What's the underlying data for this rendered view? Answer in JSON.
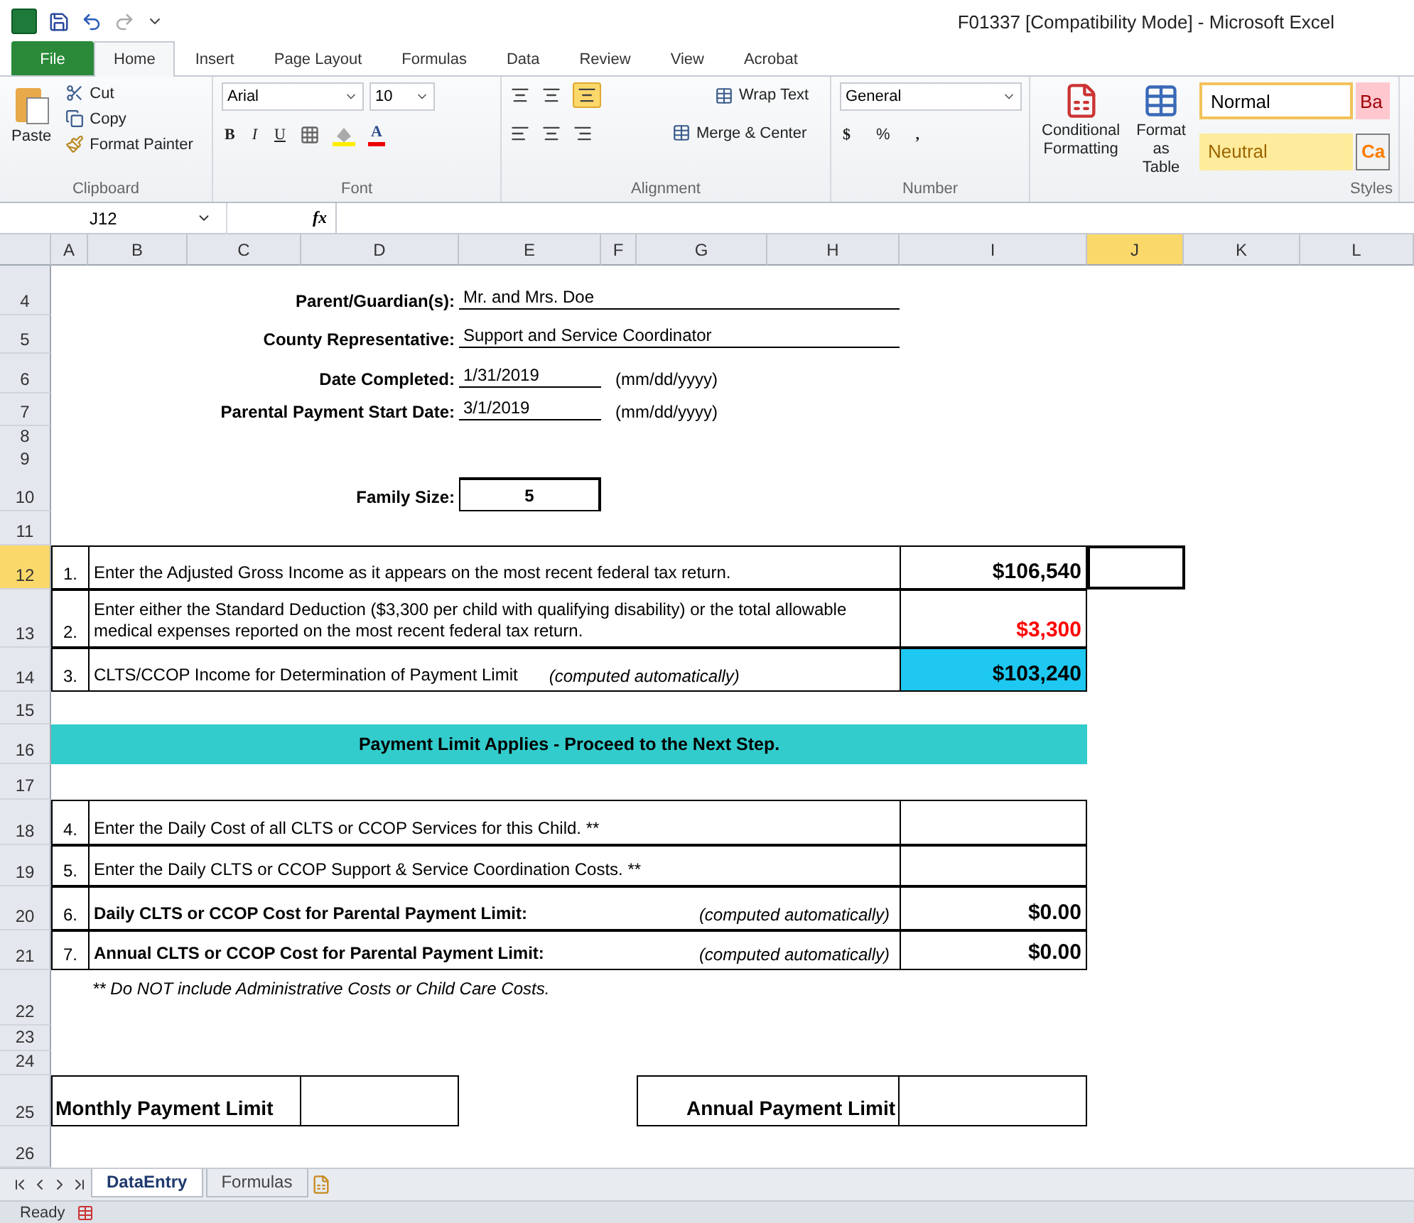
{
  "window": {
    "title": "F01337  [Compatibility Mode]  -  Microsoft Excel"
  },
  "ribbon_tabs": [
    {
      "label": "File",
      "kind": "file",
      "selected": false
    },
    {
      "label": "Home",
      "kind": "tab",
      "selected": true
    },
    {
      "label": "Insert",
      "kind": "tab",
      "selected": false
    },
    {
      "label": "Page Layout",
      "kind": "tab",
      "selected": false
    },
    {
      "label": "Formulas",
      "kind": "tab",
      "selected": false
    },
    {
      "label": "Data",
      "kind": "tab",
      "selected": false
    },
    {
      "label": "Review",
      "kind": "tab",
      "selected": false
    },
    {
      "label": "View",
      "kind": "tab",
      "selected": false
    },
    {
      "label": "Acrobat",
      "kind": "tab",
      "selected": false
    }
  ],
  "clipboard": {
    "label": "Clipboard",
    "paste": "Paste",
    "cut": "Cut",
    "copy": "Copy",
    "format_painter": "Format Painter"
  },
  "font": {
    "label": "Font",
    "name": "Arial",
    "size": "10",
    "bold": "B",
    "italic": "I",
    "underline": "U",
    "font_color": "A"
  },
  "alignment": {
    "label": "Alignment",
    "wrap_text": "Wrap Text",
    "merge": "Merge & Center"
  },
  "number": {
    "label": "Number",
    "format": "General",
    "currency": "$",
    "percent": "%",
    "comma": ","
  },
  "styles": {
    "label": "Styles",
    "conditional": "Conditional Formatting",
    "format_table": "Format as Table",
    "cells": [
      {
        "label": "Normal",
        "kind": "normal"
      },
      {
        "label": "Ba",
        "kind": "bad"
      },
      {
        "label": "Neutral",
        "kind": "neutral"
      },
      {
        "label": "Ca",
        "kind": "calc"
      }
    ]
  },
  "formula_bar": {
    "name_box": "J12",
    "function_label": "fx"
  },
  "columns": [
    {
      "label": "A",
      "selected": false
    },
    {
      "label": "B",
      "selected": false
    },
    {
      "label": "C",
      "selected": false
    },
    {
      "label": "D",
      "selected": false
    },
    {
      "label": "E",
      "selected": false
    },
    {
      "label": "F",
      "selected": false
    },
    {
      "label": "G",
      "selected": false
    },
    {
      "label": "H",
      "selected": false
    },
    {
      "label": "I",
      "selected": false
    },
    {
      "label": "J",
      "selected": true
    },
    {
      "label": "K",
      "selected": false
    },
    {
      "label": "L",
      "selected": false
    }
  ],
  "rows": [
    {
      "number": "4",
      "kind": "label_value",
      "selected": false,
      "label": "Parent/Guardian(s):",
      "value": "Mr. and Mrs. Doe"
    },
    {
      "number": "5",
      "kind": "label_value",
      "selected": false,
      "label": "County Representative:",
      "value": "Support and Service Coordinator"
    },
    {
      "number": "6",
      "kind": "label_value",
      "selected": false,
      "label": "Date Completed:",
      "value": "1/31/2019",
      "hint": "(mm/dd/yyyy)"
    },
    {
      "number": "7",
      "kind": "label_value",
      "selected": false,
      "label": "Parental Payment Start Date:",
      "value": "3/1/2019",
      "hint": "(mm/dd/yyyy)"
    },
    {
      "number": "8",
      "kind": "blank",
      "selected": false
    },
    {
      "number": "9",
      "kind": "blank",
      "selected": false
    },
    {
      "number": "10",
      "kind": "boxed",
      "selected": false,
      "label": "Family Size:",
      "value": "5"
    },
    {
      "number": "11",
      "kind": "blank",
      "selected": false
    },
    {
      "number": "12",
      "kind": "numbered",
      "selected": true,
      "bold": false,
      "highlighted": false,
      "index": "1.",
      "text": "Enter the Adjusted Gross Income as it appears on the most recent federal tax return.",
      "amount": "$106,540",
      "color": "#000000"
    },
    {
      "number": "13",
      "kind": "numbered",
      "selected": false,
      "bold": false,
      "highlighted": false,
      "index": "2.",
      "text": "Enter either the Standard Deduction ($3,300 per child with qualifying disability) or the total allowable medical expenses reported on the most recent federal tax return.",
      "amount": "$3,300",
      "color": "#ff0000"
    },
    {
      "number": "14",
      "kind": "numbered",
      "selected": false,
      "bold": false,
      "highlighted": true,
      "index": "3.",
      "text": "CLTS/CCOP Income for Determination of Payment Limit",
      "note": "(computed automatically)",
      "amount": "$103,240",
      "color": "#000000"
    },
    {
      "number": "15",
      "kind": "blank",
      "selected": false
    },
    {
      "number": "16",
      "kind": "banner",
      "selected": false,
      "text": "Payment Limit Applies - Proceed to the Next Step."
    },
    {
      "number": "17",
      "kind": "blank",
      "selected": false
    },
    {
      "number": "18",
      "kind": "numbered",
      "selected": false,
      "bold": false,
      "highlighted": false,
      "index": "4.",
      "text": "Enter the Daily Cost of all CLTS or CCOP Services for this Child. **"
    },
    {
      "number": "19",
      "kind": "numbered",
      "selected": false,
      "bold": false,
      "highlighted": false,
      "index": "5.",
      "text": "Enter the Daily CLTS or CCOP Support & Service Coordination Costs. **"
    },
    {
      "number": "20",
      "kind": "numbered",
      "selected": false,
      "bold": true,
      "highlighted": false,
      "index": "6.",
      "text": "Daily CLTS or CCOP Cost for Parental Payment Limit:",
      "note": "(computed automatically)",
      "amount": "$0.00",
      "color": "#000000"
    },
    {
      "number": "21",
      "kind": "numbered",
      "selected": false,
      "bold": true,
      "highlighted": false,
      "index": "7.",
      "text": "Annual CLTS or CCOP Cost for Parental Payment Limit:",
      "note": "(computed automatically)",
      "amount": "$0.00",
      "color": "#000000"
    },
    {
      "number": "22",
      "kind": "footnote",
      "selected": false,
      "text": "** Do NOT include Administrative Costs or Child Care Costs."
    },
    {
      "number": "23",
      "kind": "blank",
      "selected": false
    },
    {
      "number": "24",
      "kind": "blank",
      "selected": false
    },
    {
      "number": "25",
      "kind": "limits",
      "selected": false,
      "labels": [
        "Monthly Payment Limit",
        "Annual Payment Limit"
      ]
    },
    {
      "number": "26",
      "kind": "blank",
      "selected": false
    }
  ],
  "sheet_tabs": [
    {
      "label": "DataEntry",
      "selected": true
    },
    {
      "label": "Formulas",
      "selected": false
    }
  ],
  "status_bar": {
    "text": "Ready"
  }
}
